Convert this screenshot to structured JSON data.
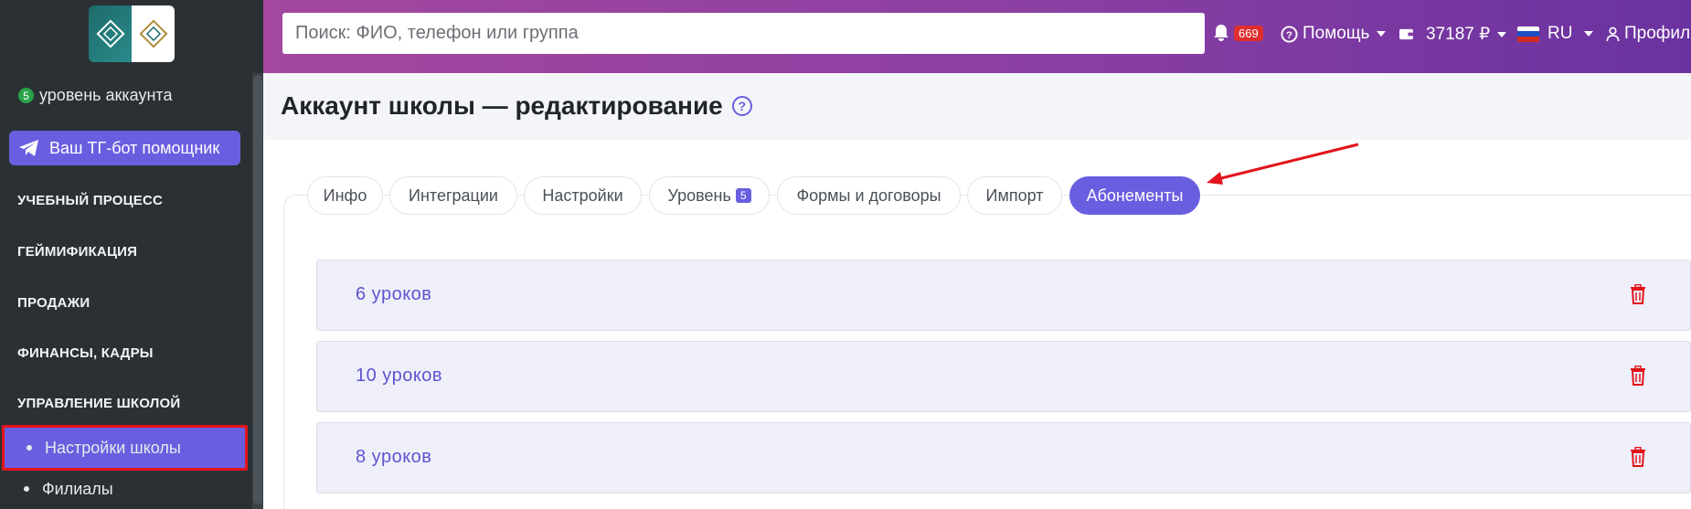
{
  "sidebar": {
    "account_level_count": "5",
    "account_level_label": "уровень аккаунта",
    "tg_button_label": "Ваш ТГ-бот помощник",
    "nav": [
      "УЧЕБНЫЙ ПРОЦЕСС",
      "ГЕЙМИФИКАЦИЯ",
      "ПРОДАЖИ",
      "ФИНАНСЫ, КАДРЫ",
      "УПРАВЛЕНИЕ ШКОЛОЙ"
    ],
    "subitems": [
      {
        "label": "Настройки школы",
        "active": true
      },
      {
        "label": "Филиалы",
        "active": false
      }
    ]
  },
  "topbar": {
    "search_placeholder": "Поиск: ФИО, телефон или группа",
    "notifications_count": "669",
    "help_label": "Помощь",
    "balance": "37187 ₽",
    "language": "RU",
    "profile_label": "Профиль"
  },
  "page": {
    "title": "Аккаунт школы — редактирование",
    "help_icon_text": "?"
  },
  "tabs": [
    {
      "label": "Инфо"
    },
    {
      "label": "Интеграции"
    },
    {
      "label": "Настройки"
    },
    {
      "label": "Уровень",
      "badge": "5"
    },
    {
      "label": "Формы и договоры"
    },
    {
      "label": "Импорт"
    },
    {
      "label": "Абонементы",
      "active": true
    }
  ],
  "subscriptions": [
    {
      "label": "6 уроков"
    },
    {
      "label": "10 уроков"
    },
    {
      "label": "8 уроков"
    }
  ],
  "colors": {
    "accent": "#6a5ee0",
    "sidebar_bg": "#2b3035",
    "danger": "#e3141b",
    "topbar_gradient_start": "#a4479e",
    "topbar_gradient_end": "#6a32a0"
  }
}
